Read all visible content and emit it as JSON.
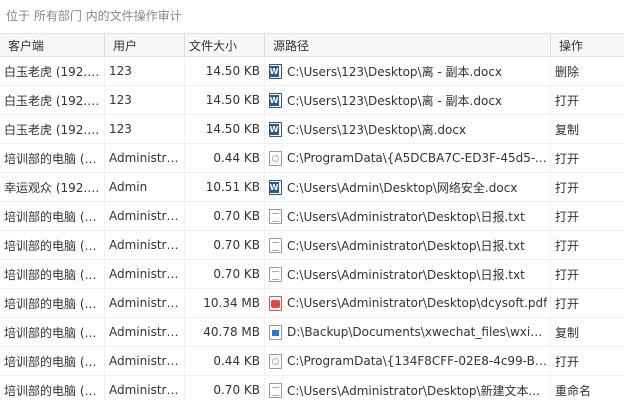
{
  "header": {
    "caption": "位于 所有部门 内的文件操作审计"
  },
  "columns": [
    "客户端",
    "用户",
    "文件大小",
    "源路径",
    "操作"
  ],
  "rows": [
    {
      "client": "白玉老虎 (192.1...",
      "user": "123",
      "size": "14.50 KB",
      "icon": "word-icon",
      "path": "C:\\Users\\123\\Desktop\\离 - 副本.docx",
      "action": "删除"
    },
    {
      "client": "白玉老虎 (192.1...",
      "user": "123",
      "size": "14.50 KB",
      "icon": "word-icon",
      "path": "C:\\Users\\123\\Desktop\\离 - 副本.docx",
      "action": "打开"
    },
    {
      "client": "白玉老虎 (192.1...",
      "user": "123",
      "size": "14.50 KB",
      "icon": "word-icon",
      "path": "C:\\Users\\123\\Desktop\\离.docx",
      "action": "复制"
    },
    {
      "client": "培训部的电脑 (1...",
      "user": "Administrat...",
      "size": "0.44 KB",
      "icon": "system-file-icon",
      "path": "C:\\ProgramData\\{A5DCBA7C-ED3F-45d5-B...",
      "action": "打开"
    },
    {
      "client": "幸运观众 (192.1...",
      "user": "Admin",
      "size": "10.51 KB",
      "icon": "word-icon",
      "path": "C:\\Users\\Admin\\Desktop\\网络安全.docx",
      "action": "打开"
    },
    {
      "client": "培训部的电脑 (1...",
      "user": "Administrat...",
      "size": "0.70 KB",
      "icon": "text-file-icon",
      "path": "C:\\Users\\Administrator\\Desktop\\日报.txt",
      "action": "打开"
    },
    {
      "client": "培训部的电脑 (1...",
      "user": "Administrat...",
      "size": "0.70 KB",
      "icon": "text-file-icon",
      "path": "C:\\Users\\Administrator\\Desktop\\日报.txt",
      "action": "打开"
    },
    {
      "client": "培训部的电脑 (1...",
      "user": "Administrat...",
      "size": "0.70 KB",
      "icon": "text-file-icon",
      "path": "C:\\Users\\Administrator\\Desktop\\日报.txt",
      "action": "打开"
    },
    {
      "client": "培训部的电脑 (1...",
      "user": "Administrat...",
      "size": "10.34 MB",
      "icon": "pdf-icon",
      "path": "C:\\Users\\Administrator\\Desktop\\dcysoft.pdf",
      "action": "打开"
    },
    {
      "client": "培训部的电脑 (1...",
      "user": "Administrat...",
      "size": "40.78 MB",
      "icon": "image-file-icon",
      "path": "D:\\Backup\\Documents\\xwechat_files\\wxid...",
      "action": "复制"
    },
    {
      "client": "培训部的电脑 (1...",
      "user": "Administrat...",
      "size": "0.44 KB",
      "icon": "system-file-icon",
      "path": "C:\\ProgramData\\{134F8CFF-02E8-4c99-B2...",
      "action": "打开"
    },
    {
      "client": "培训部的电脑 (1...",
      "user": "Administrat...",
      "size": "0.70 KB",
      "icon": "text-file-icon",
      "path": "C:\\Users\\Administrator\\Desktop\\新建文本...",
      "action": "重命名"
    }
  ]
}
